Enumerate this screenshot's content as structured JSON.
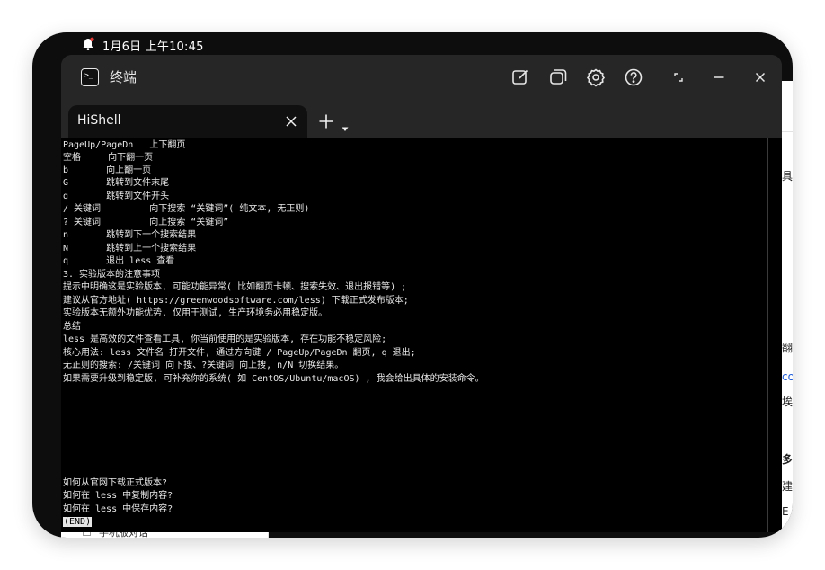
{
  "statusbar": {
    "time": "1月6日 上午10:45"
  },
  "window": {
    "title": "终端"
  },
  "tabs": [
    {
      "label": "HiShell"
    }
  ],
  "terminal": {
    "lines": [
      "PageUp/PageDn   上下翻页",
      "空格     向下翻一页",
      "b       向上翻一页",
      "G       跳转到文件末尾",
      "g       跳转到文件开头",
      "/ 关键词         向下搜索 “关键词”( 纯文本, 无正则)",
      "? 关键词         向上搜索 “关键词”",
      "n       跳转到下一个搜索结果",
      "N       跳转到上一个搜索结果",
      "q       退出 less 查看",
      "3. 实验版本的注意事项",
      "提示中明确这是实验版本, 可能功能异常( 比如翻页卡顿、搜索失效、退出报错等) ;",
      "建议从官方地址( https://greenwoodsoftware.com/less) 下载正式发布版本;",
      "实验版本无额外功能优势, 仅用于测试, 生产环境务必用稳定版。",
      "总结",
      "less 是高效的文件查看工具, 你当前使用的是实验版本, 存在功能不稳定风险;",
      "核心用法: less 文件名 打开文件, 通过方向键 / PageUp/PageDn 翻页, q 退出;",
      "无正则的搜索: /关键词 向下搜、?关键词 向上搜, n/N 切换结果。",
      "如果需要升级到稳定版, 可补充你的系统( 如 CentOS/Ubuntu/macOS) , 我会给出具体的安装命令。"
    ],
    "bottom_lines": [
      "如何从官网下载正式版本?",
      "如何在 less 中复制内容?",
      "如何在 less 中保存内容?"
    ],
    "end_marker": "(END)"
  },
  "background": {
    "right_glyphs": [
      "具",
      "翻",
      "co",
      "埃",
      "多",
      "建",
      "E"
    ],
    "bottom_item": "手机版对话"
  },
  "icons": {
    "bell": "notification-bell-icon",
    "app": "terminal-app-icon",
    "edit": "edit-square-icon",
    "multi_window": "multi-window-icon",
    "settings": "gear-icon",
    "help": "help-icon",
    "fullscreen": "fullscreen-icon",
    "minimize": "minimize-icon",
    "close": "close-icon",
    "tab_close": "tab-close-icon",
    "new_tab": "plus-icon",
    "tab_menu": "caret-down-icon"
  },
  "colors": {
    "terminal_bg": "#000000",
    "chrome_bg": "#262626",
    "accent_red": "#e53935"
  }
}
